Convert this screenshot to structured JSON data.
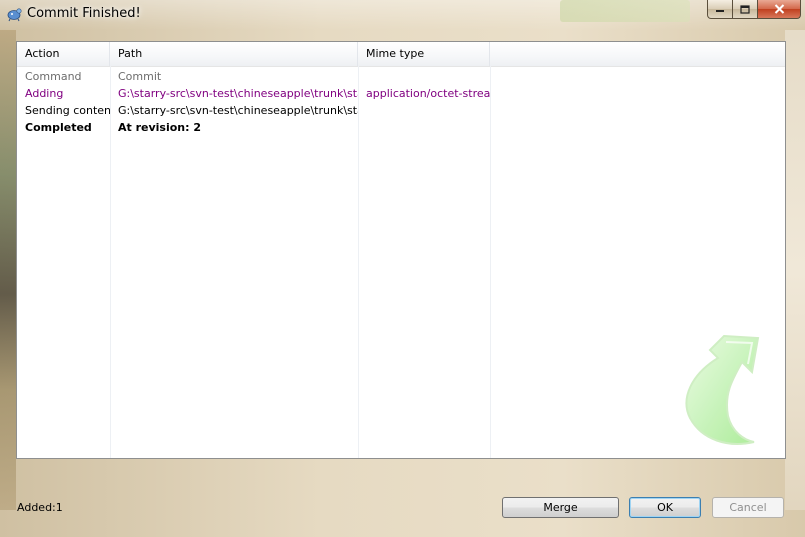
{
  "window": {
    "title": "Commit Finished!",
    "controls": {
      "minimize": "minimize",
      "maximize": "maximize",
      "close": "close"
    }
  },
  "list": {
    "columns": [
      "Action",
      "Path",
      "Mime type",
      ""
    ],
    "rows": [
      {
        "type": "command",
        "action": "Command",
        "path": "Commit",
        "mime": ""
      },
      {
        "type": "adding",
        "action": "Adding",
        "path": "G:\\starry-src\\svn-test\\chineseapple\\trunk\\starry",
        "mime": "application/octet-stream"
      },
      {
        "type": "sending",
        "action": "Sending content",
        "path": "G:\\starry-src\\svn-test\\chineseapple\\trunk\\starry",
        "mime": ""
      },
      {
        "type": "completed",
        "action": "Completed",
        "path": "At revision: 2",
        "mime": ""
      }
    ]
  },
  "status": {
    "added": "Added:1"
  },
  "buttons": {
    "merge": "Merge",
    "ok": "OK",
    "cancel": "Cancel"
  },
  "icons": {
    "app": "tortoisesvn-icon",
    "watermark": "green-commit-arrow-icon"
  },
  "colors": {
    "adding_text": "#800080",
    "command_text": "#6d6d6d",
    "arrow": "#b8f0a8"
  }
}
